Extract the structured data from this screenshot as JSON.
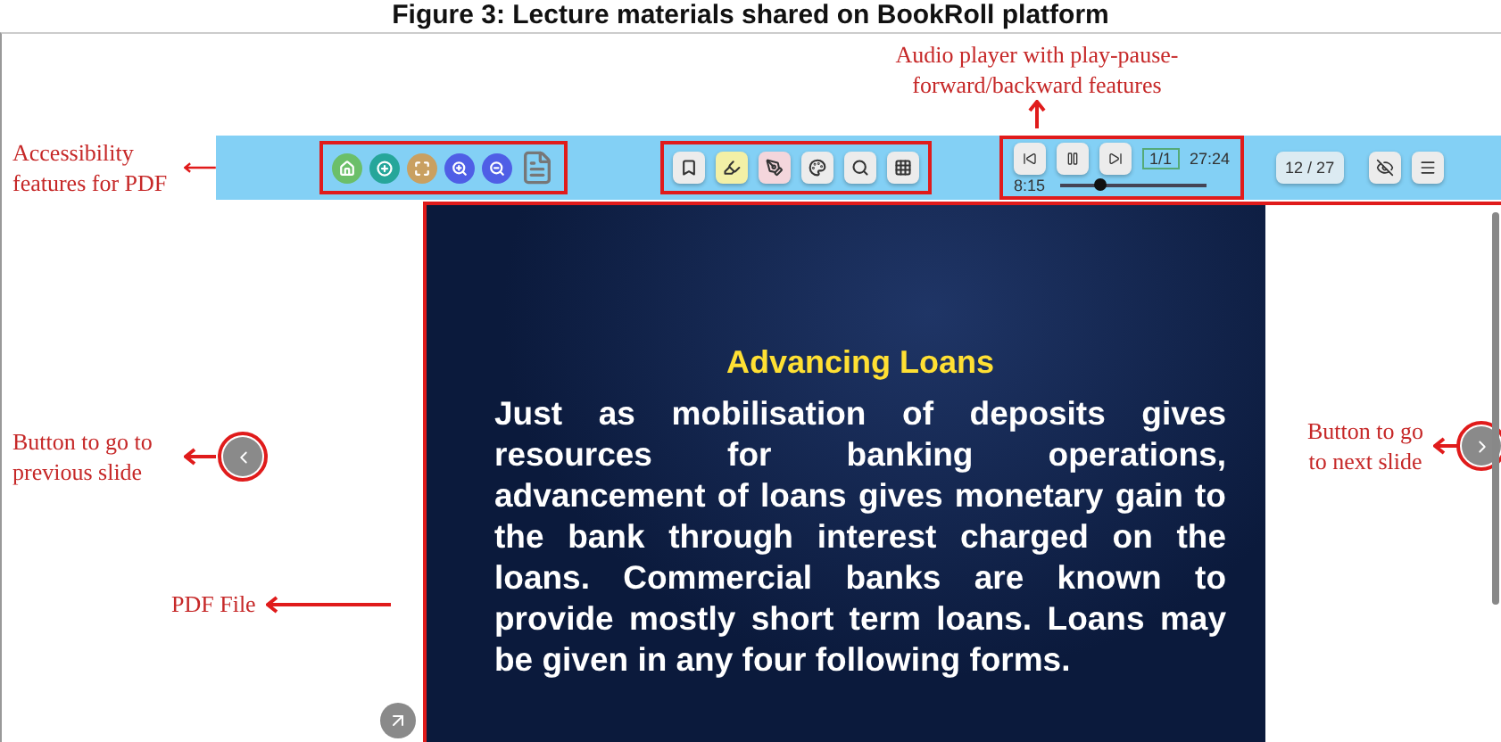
{
  "caption": "Figure 3: Lecture materials shared on BookRoll platform",
  "annotations": {
    "audio": "Audio player with play-pause-forward/backward features",
    "accessibility": "Accessibility features for PDF",
    "previous": "Button to go to previous slide",
    "next": "Button to go to next slide",
    "pdf": "PDF File"
  },
  "accessibility_buttons": [
    {
      "kind": "home",
      "color": "#6bbf69"
    },
    {
      "kind": "add",
      "color": "#26a69a"
    },
    {
      "kind": "fullscreen",
      "color": "#c9a061"
    },
    {
      "kind": "zoom-in",
      "color": "#4f5ee6"
    },
    {
      "kind": "zoom-out",
      "color": "#4f5ee6"
    },
    {
      "kind": "document"
    }
  ],
  "tool_buttons": [
    {
      "kind": "bookmark"
    },
    {
      "kind": "highlighter"
    },
    {
      "kind": "marker"
    },
    {
      "kind": "palette"
    },
    {
      "kind": "search"
    },
    {
      "kind": "grid"
    }
  ],
  "audio_player": {
    "track": "1/1",
    "duration": "27:24",
    "position": "8:15",
    "level": 0.28
  },
  "page_counter": "12 / 27",
  "slide": {
    "title": "Advancing Loans",
    "body": "Just as mobilisation of deposits gives resources for banking operations, advancement of loans gives monetary gain to the bank through interest charged on the loans. Commercial banks are known to provide mostly short term loans. Loans may be given in any four following forms."
  }
}
